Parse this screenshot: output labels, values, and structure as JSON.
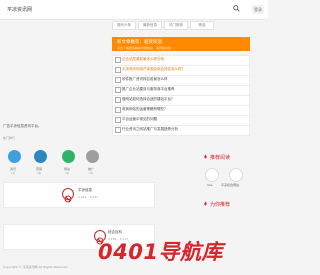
{
  "header": {
    "logo": "平凉资讯网",
    "login_label": "登录"
  },
  "nav_tabs": [
    "福号头条",
    "最新信息",
    "热门推荐",
    "精选"
  ],
  "banner": {
    "title": "新文章推荐：超受欢迎",
    "subtitle": "点击了解更多精彩内容信息，请持续关注 ›"
  },
  "rec_list": [
    {
      "text": "企业站发展前景怎么样分析",
      "color": "#e67300"
    },
    {
      "text": "平凉资讯网用户体验及综合排名怎么样？",
      "color": "#e67300"
    },
    {
      "text": "软件推广资讯排名前景怎么样",
      "color": "#444444"
    },
    {
      "text": "推广企业站建设与服务商平台推荐",
      "color": "#444444"
    },
    {
      "text": "做网站如何选择合适的建站平台？",
      "color": "#444444"
    },
    {
      "text": "电商网站的运营策略有哪些？",
      "color": "#444444"
    },
    {
      "text": "平台运营中常见的问题",
      "color": "#444444"
    },
    {
      "text": "行业资讯之网站推广与发展趋势分析",
      "color": "#444444"
    }
  ],
  "intro": {
    "line1": "广告平凉信息资讯平台。",
    "line2": "热门排行"
  },
  "circles": [
    {
      "label": "资讯",
      "sub": "1条",
      "color": "#3fa0e0"
    },
    {
      "label": "营销",
      "sub": "5条",
      "color": "#2e86c1"
    },
    {
      "label": "网站",
      "sub": "3条",
      "color": "#2fb36b"
    },
    {
      "label": "推广",
      "sub": "2条",
      "color": "#9e9e9e"
    }
  ],
  "cards": [
    {
      "title": "平凉信息",
      "meta": "1,011 · 2,041"
    },
    {
      "title": "综合百科",
      "meta": "1,150 · 5,117"
    }
  ],
  "sidebar": {
    "recommend_title": "推荐阅读",
    "recommend_items": [
      "Vea",
      "平凉综合网站"
    ],
    "hot_title": "为你推荐"
  },
  "footer": {
    "text": "Copyright © 平凉资讯网 All Rights Reserved"
  },
  "watermark": "0401导航库",
  "colors": {
    "accent": "#d6262d",
    "banner": "#ff8a00"
  }
}
